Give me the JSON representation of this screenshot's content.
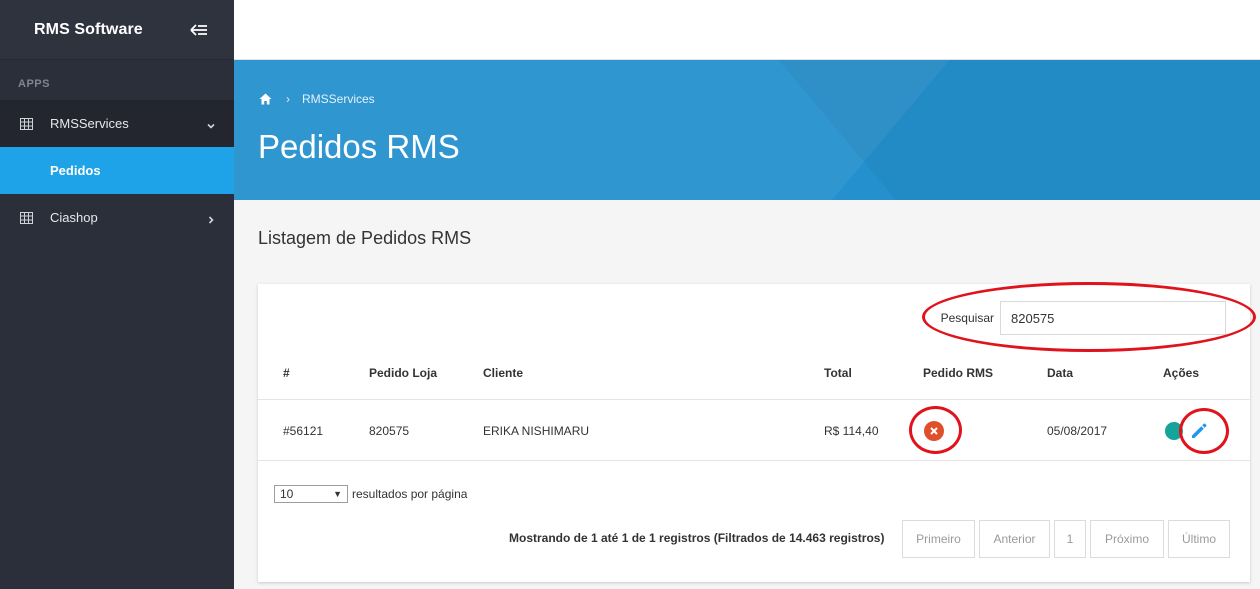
{
  "sidebar": {
    "brand": "RMS Software",
    "section": "APPS",
    "items": [
      {
        "label": "RMSServices"
      },
      {
        "label": "Pedidos"
      },
      {
        "label": "Ciashop"
      }
    ]
  },
  "hero": {
    "breadcrumb": "RMSServices",
    "title": "Pedidos RMS"
  },
  "content": {
    "title": "Listagem de Pedidos RMS"
  },
  "search": {
    "label": "Pesquisar",
    "value": "820575"
  },
  "table": {
    "columns": [
      "#",
      "Pedido Loja",
      "Cliente",
      "Total",
      "Pedido RMS",
      "Data",
      "Ações"
    ],
    "rows": [
      {
        "id": "#56121",
        "pedido_loja": "820575",
        "cliente": "ERIKA NISHIMARU",
        "total": "R$ 114,40",
        "pedido_rms": "error",
        "data": "05/08/2017"
      }
    ]
  },
  "pagination": {
    "page_size": "10",
    "page_size_label": "resultados por página",
    "info": "Mostrando de 1 até 1 de 1 registros (Filtrados de 14.463 registros)",
    "buttons": [
      "Primeiro",
      "Anterior",
      "1",
      "Próximo",
      "Último"
    ]
  },
  "colors": {
    "sidebar": "#2b2f3a",
    "accent": "#1ea3e8",
    "hero": "#2490ce",
    "error": "#e04f2c",
    "annotation": "#e0121b"
  }
}
